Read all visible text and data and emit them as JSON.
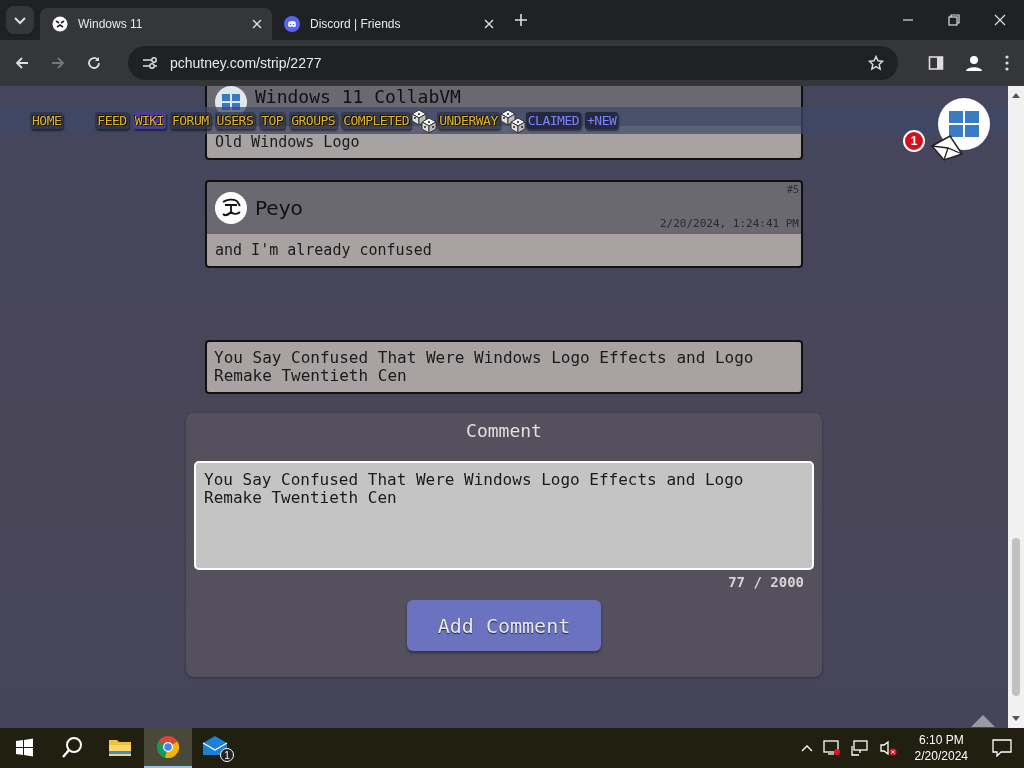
{
  "browser": {
    "tabs": [
      {
        "title": "Windows 11",
        "selected": true,
        "kind": "site"
      },
      {
        "title": "Discord | Friends",
        "selected": false,
        "kind": "discord"
      }
    ],
    "address": "pchutney.com/strip/2277"
  },
  "nav": {
    "items": [
      {
        "label": "HOME",
        "kind": "gold",
        "selected": false,
        "dice": false
      },
      {
        "label": "FEED",
        "kind": "gold",
        "selected": false,
        "dice": false
      },
      {
        "label": "WIKI",
        "kind": "gold",
        "selected": true,
        "dice": false
      },
      {
        "label": "FORUM",
        "kind": "gold",
        "selected": false,
        "dice": false
      },
      {
        "label": "USERS",
        "kind": "gold",
        "selected": false,
        "dice": false
      },
      {
        "label": "TOP",
        "kind": "gold",
        "selected": false,
        "dice": false
      },
      {
        "label": "GROUPS",
        "kind": "gold",
        "selected": false,
        "dice": false
      },
      {
        "label": "COMPLETED",
        "kind": "gold",
        "selected": false,
        "dice": true
      },
      {
        "label": "UNDERWAY",
        "kind": "gold",
        "selected": false,
        "dice": true
      },
      {
        "label": "CLAIMED",
        "kind": "blue",
        "selected": false,
        "dice": false
      },
      {
        "label": "+NEW",
        "kind": "blue",
        "selected": false,
        "dice": false
      }
    ]
  },
  "user_menu": {
    "badge": "1"
  },
  "posts": [
    {
      "author": "Windows 11 CollabVM",
      "kind": "windows",
      "body": "Old Windows Logo"
    },
    {
      "author": "Peyo",
      "kind": "doodle",
      "number": "#5",
      "time": "2/20/2024, 1:24:41 PM",
      "body": "and I'm already confused"
    }
  ],
  "preview": {
    "text": "You Say Confused That Were Windows Logo Effects and Logo Remake Twentieth Cen"
  },
  "comment_form": {
    "title": "Comment",
    "value": "You Say Confused That Were Windows Logo Effects and Logo Remake Twentieth Cen",
    "counter": "77 / 2000",
    "button": "Add Comment"
  },
  "taskbar": {
    "apps": [
      {
        "kind": "explorer",
        "active": false
      },
      {
        "kind": "chrome",
        "active": true
      },
      {
        "kind": "mail",
        "active": false,
        "badge": "1"
      }
    ],
    "time": "6:10 PM",
    "date": "2/20/2024"
  }
}
